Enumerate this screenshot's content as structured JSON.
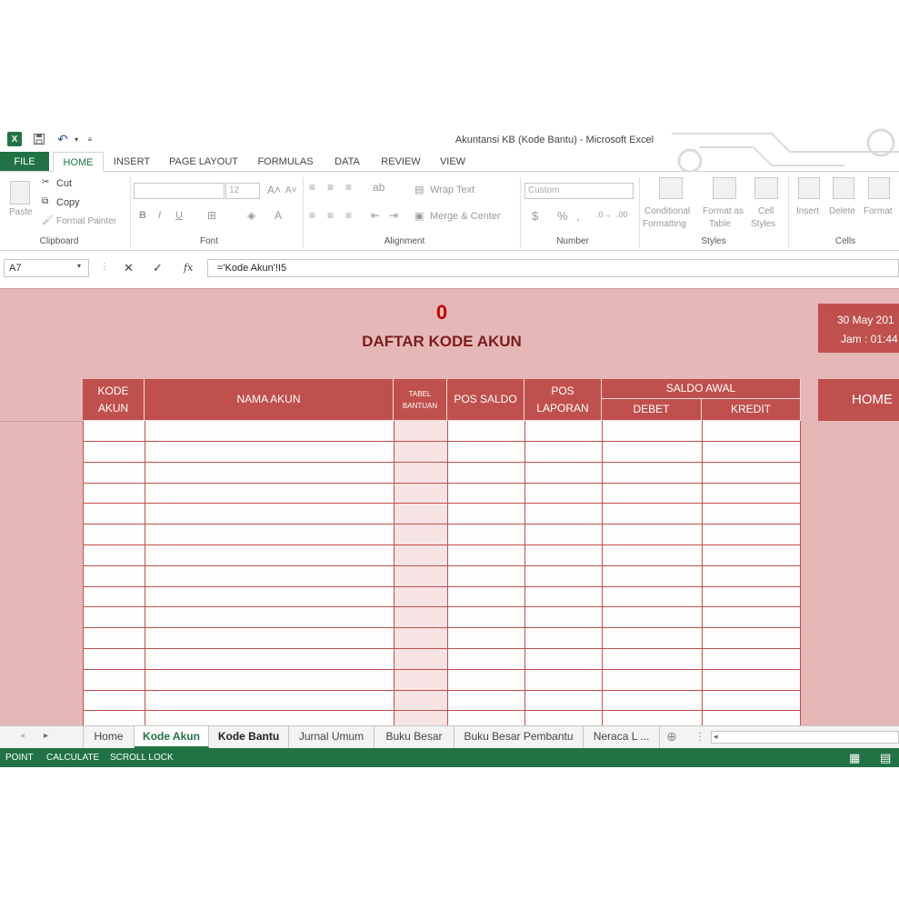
{
  "window": {
    "title": "Akuntansi KB (Kode Bantu) - Microsoft Excel"
  },
  "ribbon_tabs": [
    "FILE",
    "HOME",
    "INSERT",
    "PAGE LAYOUT",
    "FORMULAS",
    "DATA",
    "REVIEW",
    "VIEW"
  ],
  "ribbon": {
    "clipboard": {
      "paste": "Paste",
      "cut": "Cut",
      "copy": "Copy",
      "format_painter": "Format Painter",
      "label": "Clipboard"
    },
    "font": {
      "size": "12",
      "bold": "B",
      "italic": "I",
      "underline": "U",
      "label": "Font"
    },
    "alignment": {
      "wrap_text": "Wrap Text",
      "merge_center": "Merge & Center",
      "label": "Alignment"
    },
    "number": {
      "format": "Custom",
      "currency": "$",
      "percent": "%",
      "label": "Number"
    },
    "styles": {
      "conditional_1": "Conditional",
      "conditional_2": "Formatting",
      "format_table_1": "Format as",
      "format_table_2": "Table",
      "cell_styles_1": "Cell",
      "cell_styles_2": "Styles",
      "label": "Styles"
    },
    "cells": {
      "insert": "Insert",
      "delete": "Delete",
      "format": "Format",
      "label": "Cells"
    }
  },
  "formula_bar": {
    "name_box": "A7",
    "fx": "fx",
    "formula": "='Kode Akun'!I5"
  },
  "sheet": {
    "counter": "0",
    "heading": "DAFTAR KODE AKUN",
    "date": "30 May 201",
    "time": "Jam : 01:44",
    "home_button": "HOME",
    "headers": {
      "kode_akun_1": "KODE",
      "kode_akun_2": "AKUN",
      "nama_akun": "NAMA AKUN",
      "tabel_1": "TABEL",
      "tabel_2": "BANTUAN",
      "pos_saldo": "POS SALDO",
      "pos_laporan_1": "POS",
      "pos_laporan_2": "LAPORAN",
      "saldo_awal": "SALDO AWAL",
      "debet": "DEBET",
      "kredit": "KREDIT"
    }
  },
  "sheet_tabs": [
    "Home",
    "Kode Akun",
    "Kode Bantu",
    "Jurnal Umum",
    "Buku Besar",
    "Buku Besar Pembantu",
    "Neraca L ..."
  ],
  "status_bar": {
    "mode": "POINT",
    "calc": "CALCULATE",
    "scroll": "SCROLL LOCK"
  },
  "colors": {
    "excel_green": "#217346",
    "header_red": "#c0504d",
    "sheet_bg": "#e5b8b7",
    "title_red": "#c00000"
  }
}
